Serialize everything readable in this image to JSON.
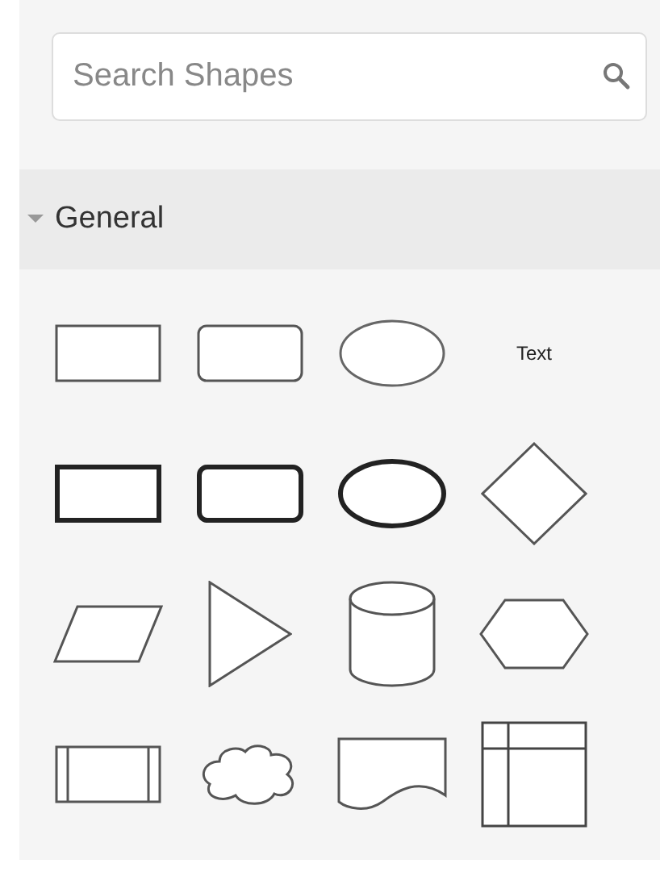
{
  "search": {
    "placeholder": "Search Shapes"
  },
  "section": {
    "title": "General",
    "expanded": true
  },
  "shapes": [
    {
      "kind": "rectangle"
    },
    {
      "kind": "rounded-rectangle"
    },
    {
      "kind": "ellipse"
    },
    {
      "kind": "text",
      "label": "Text"
    },
    {
      "kind": "bold-rectangle"
    },
    {
      "kind": "bold-rounded-rectangle"
    },
    {
      "kind": "bold-ellipse"
    },
    {
      "kind": "diamond"
    },
    {
      "kind": "parallelogram"
    },
    {
      "kind": "triangle"
    },
    {
      "kind": "cylinder"
    },
    {
      "kind": "hexagon"
    },
    {
      "kind": "process"
    },
    {
      "kind": "cloud"
    },
    {
      "kind": "document"
    },
    {
      "kind": "internal-storage"
    }
  ]
}
